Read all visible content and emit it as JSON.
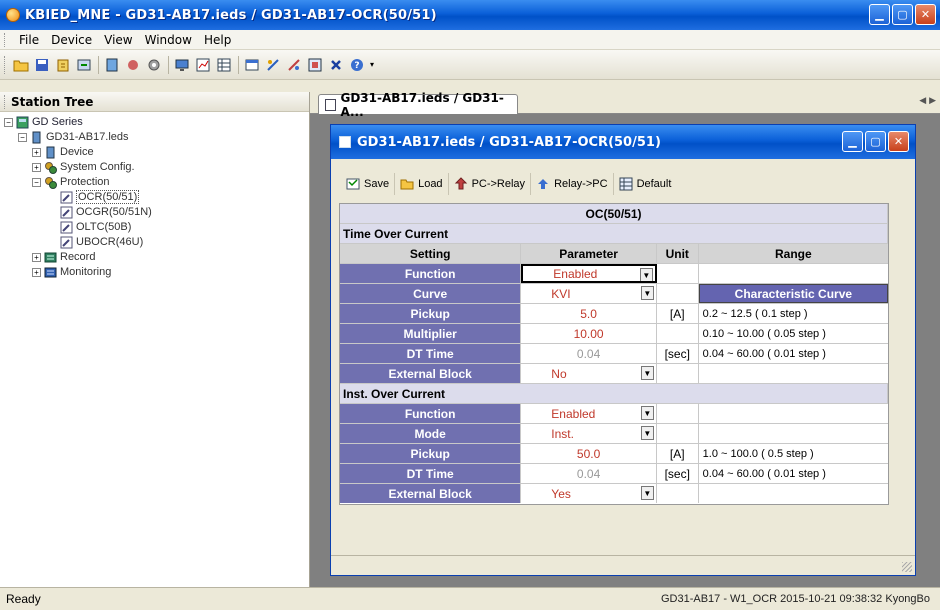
{
  "window": {
    "title": "KBIED_MNE - GD31-AB17.ieds / GD31-AB17-OCR(50/51)"
  },
  "menu": [
    "File",
    "Device",
    "View",
    "Window",
    "Help"
  ],
  "toolbar_icons": [
    "open-icon",
    "save-icon",
    "load-icon",
    "export-icon",
    "station-icon",
    "device-icon",
    "settings-icon",
    "monitor-icon",
    "chart-icon",
    "table-icon",
    "window-icon",
    "tile-icon",
    "cascade-icon",
    "layout-icon",
    "close-icon",
    "help-icon"
  ],
  "tree": {
    "header": "Station Tree",
    "nodes": [
      {
        "label": "GD Series"
      },
      {
        "label": "GD31-AB17.leds"
      },
      {
        "label": "Device"
      },
      {
        "label": "System Config."
      },
      {
        "label": "Protection"
      },
      {
        "label": "OCR(50/51)"
      },
      {
        "label": "OCGR(50/51N)"
      },
      {
        "label": "OLTC(50B)"
      },
      {
        "label": "UBOCR(46U)"
      },
      {
        "label": "Record"
      },
      {
        "label": "Monitoring"
      }
    ]
  },
  "tab": {
    "label": "GD31-AB17.ieds / GD31-A...",
    "nav": "◀ ▶"
  },
  "child": {
    "title": "GD31-AB17.ieds / GD31-AB17-OCR(50/51)",
    "toolbar": {
      "save": "Save",
      "load": "Load",
      "pc_relay": "PC->Relay",
      "relay_pc": "Relay->PC",
      "default": "Default"
    }
  },
  "grid": {
    "group_title": "OC(50/51)",
    "sections": [
      {
        "title": "Time Over Current",
        "headers": [
          "Setting",
          "Parameter",
          "Unit",
          "Range"
        ],
        "rows": [
          {
            "setting": "Function",
            "param": "Enabled",
            "unit": "",
            "range": ""
          },
          {
            "setting": "Curve",
            "param": "KVI",
            "unit": "",
            "range": "Characteristic Curve"
          },
          {
            "setting": "Pickup",
            "param": "5.0",
            "unit": "[A]",
            "range": "0.2 ~ 12.5 ( 0.1 step )"
          },
          {
            "setting": "Multiplier",
            "param": "10.00",
            "unit": "",
            "range": "0.10 ~ 10.00 ( 0.05 step )"
          },
          {
            "setting": "DT Time",
            "param": "0.04",
            "unit": "[sec]",
            "range": "0.04 ~ 60.00 ( 0.01 step )"
          },
          {
            "setting": "External Block",
            "param": "No",
            "unit": "",
            "range": ""
          }
        ]
      },
      {
        "title": "Inst. Over Current",
        "rows": [
          {
            "setting": "Function",
            "param": "Enabled",
            "unit": "",
            "range": ""
          },
          {
            "setting": "Mode",
            "param": "Inst.",
            "unit": "",
            "range": ""
          },
          {
            "setting": "Pickup",
            "param": "50.0",
            "unit": "[A]",
            "range": "1.0 ~ 100.0 ( 0.5 step )"
          },
          {
            "setting": "DT Time",
            "param": "0.04",
            "unit": "[sec]",
            "range": "0.04 ~ 60.00 ( 0.01 step )"
          },
          {
            "setting": "External Block",
            "param": "Yes",
            "unit": "",
            "range": ""
          }
        ]
      }
    ]
  },
  "status": {
    "left": "Ready",
    "right": "GD31-AB17 - W1_OCR  2015-10-21 09:38:32  KyongBo"
  }
}
